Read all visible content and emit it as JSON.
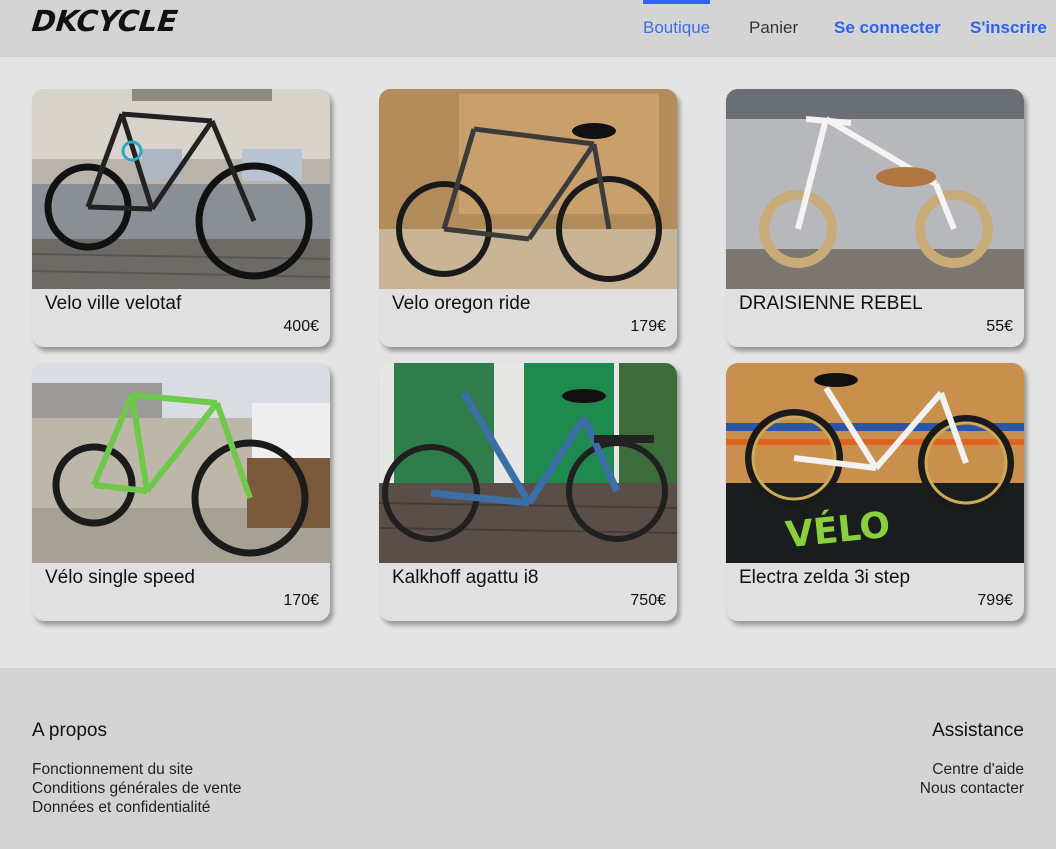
{
  "header": {
    "logo": "DKCYCLE",
    "nav": {
      "boutique": "Boutique",
      "panier": "Panier",
      "login": "Se connecter",
      "signup": "S'inscrire"
    },
    "accent_color": "#2c63f3"
  },
  "products": [
    {
      "title": "Velo ville velotaf",
      "price": "400€"
    },
    {
      "title": "Velo oregon ride",
      "price": "179€"
    },
    {
      "title": "DRAISIENNE REBEL",
      "price": "55€"
    },
    {
      "title": "Vélo single speed",
      "price": "170€"
    },
    {
      "title": "Kalkhoff agattu i8",
      "price": "750€"
    },
    {
      "title": "Electra zelda 3i step",
      "price": "799€"
    }
  ],
  "footer": {
    "about": {
      "title": "A propos",
      "links": [
        "Fonctionnement du site",
        "Conditions générales de vente",
        "Données et confidentialité"
      ]
    },
    "help": {
      "title": "Assistance",
      "links": [
        "Centre d'aide",
        "Nous contacter"
      ]
    }
  }
}
